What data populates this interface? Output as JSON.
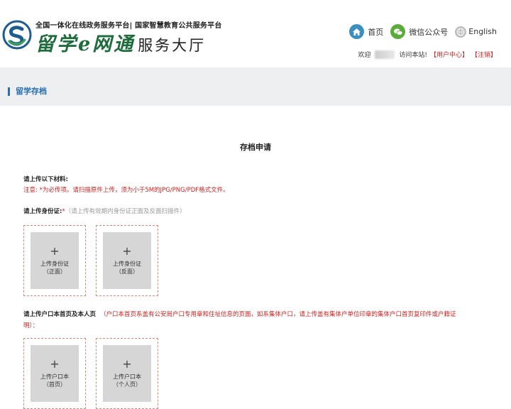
{
  "header": {
    "subtitle": "全国一体化在线政务服务平台| 国家智慧教育公共服务平台",
    "brand_name": "留学e网通",
    "brand_suffix": "服务大厅",
    "nav": {
      "home": "首页",
      "wechat": "微信公众号",
      "english": "English"
    },
    "welcome_prefix": "欢迎",
    "welcome_suffix": "访问本站!",
    "user_center": "【用户中心】",
    "logout": "【注销】"
  },
  "section": {
    "title": "留学存档"
  },
  "main": {
    "page_title": "存档申请",
    "materials_heading": "请上传以下材料:",
    "notice": "注意: *为必传项。请扫描原件上传，须为小于5M的JPG/PNG/PDF格式文件。",
    "id_card": {
      "label": "请上传身份证:",
      "required_mark": "*",
      "hint": "（请上传有效期内身份证正面及反面扫描件）",
      "front_line1": "上传身份证",
      "front_line2": "（正面）",
      "back_line1": "上传身份证",
      "back_line2": "（反面）"
    },
    "hukou": {
      "label": "请上传户口本首页及本人页",
      "hint_line1": "（户口本首页系盖有公安局户口专用章和住址信息的页面，如系集体户口，请上传盖有集体户单位印章的集体户口首页复印件或户籍证",
      "hint_line2": "明）：",
      "first_line1": "上传户口本",
      "first_line2": "（首页）",
      "personal_line1": "上传户口本",
      "personal_line2": "（个人页）"
    },
    "plus_symbol": "+"
  },
  "colors": {
    "accent_blue": "#2a6fb0",
    "notice_red": "#cc2222",
    "brand_green": "#1e6b3c"
  }
}
